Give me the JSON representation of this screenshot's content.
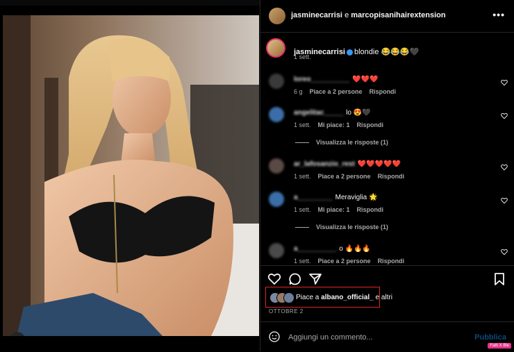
{
  "post": {
    "header_user1": "jasminecarrisi",
    "header_conj": "e",
    "header_user2": "marcopisanihairextension",
    "more_label": "•••"
  },
  "caption": {
    "username": "jasminecarrisi",
    "text": "blondie 😂😂😂🖤",
    "time": "1 sett."
  },
  "comments": [
    {
      "username": "loreo__________",
      "text": "❤️❤️❤️",
      "time": "6 g",
      "likes": "Piace a 2 persone",
      "reply": "Rispondi",
      "replies": ""
    },
    {
      "username": "angelitac_____",
      "text": "lo 😍🖤",
      "time": "1 sett.",
      "likes": "Mi piace: 1",
      "reply": "Rispondi",
      "replies": "Visualizza le risposte (1)"
    },
    {
      "username": "ar_lafosanzio_rest",
      "text": "❤️❤️❤️❤️❤️",
      "time": "1 sett.",
      "likes": "Piace a 2 persone",
      "reply": "Rispondi",
      "replies": ""
    },
    {
      "username": "a_________",
      "text": "Meraviglia 🌟",
      "time": "1 sett.",
      "likes": "Mi piace: 1",
      "reply": "Rispondi",
      "replies": "Visualizza le risposte (1)"
    },
    {
      "username": "a__________",
      "text": "o 🔥🔥🔥",
      "time": "1 sett.",
      "likes": "Piace a 2 persone",
      "reply": "Rispondi",
      "replies": ""
    }
  ],
  "likes": {
    "prefix": "Piace a",
    "user": "albano_official_",
    "suffix": "e altri"
  },
  "date": "OTTOBRE 2",
  "composer": {
    "placeholder": "Aggiungi un commento...",
    "publish": "Pubblica"
  },
  "watermark": "Fatti X Ble",
  "colors": {
    "accent": "#3897f0",
    "highlight_box": "#e02424",
    "publish_disabled": "#0c4a7a"
  },
  "icons": [
    "tag-icon",
    "more-icon",
    "verified-icon",
    "heart-icon",
    "comment-icon",
    "share-icon",
    "bookmark-icon",
    "emoji-icon"
  ]
}
